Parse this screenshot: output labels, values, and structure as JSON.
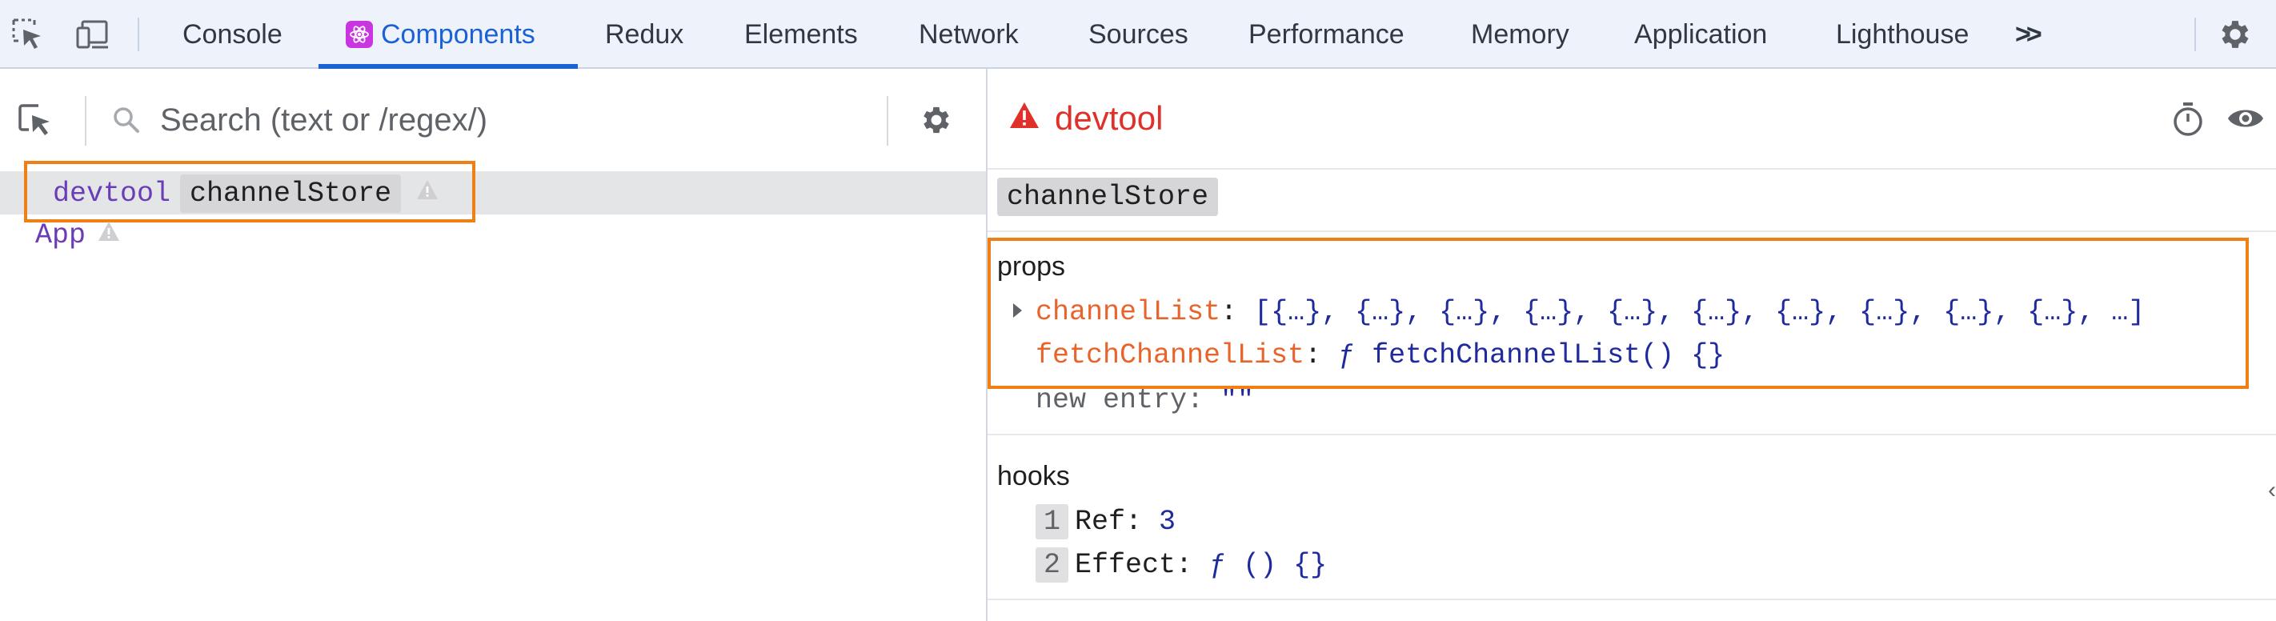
{
  "toolbar": {
    "tabs": [
      {
        "label": "Console"
      },
      {
        "label": "Components"
      },
      {
        "label": "Redux"
      },
      {
        "label": "Elements"
      },
      {
        "label": "Network"
      },
      {
        "label": "Sources"
      },
      {
        "label": "Performance"
      },
      {
        "label": "Memory"
      },
      {
        "label": "Application"
      },
      {
        "label": "Lighthouse"
      }
    ],
    "active_tab": "Components",
    "more_label": ">>"
  },
  "tree": {
    "search_placeholder": "Search (text or /regex/)",
    "items": [
      {
        "name": "devtool",
        "key": "channelStore",
        "selected": true,
        "warning": true
      },
      {
        "name": "App",
        "warning": true
      }
    ]
  },
  "inspector": {
    "component_name": "devtool",
    "key_label": "channelStore",
    "props": {
      "title": "props",
      "entries": [
        {
          "key": "channelList",
          "value": "[{…}, {…}, {…}, {…}, {…}, {…}, {…}, {…}, {…}, {…}, …]",
          "expandable": true
        },
        {
          "key": "fetchChannelList",
          "value": "ƒ fetchChannelList() {}"
        }
      ],
      "new_entry": {
        "key": "new entry",
        "value": "\"\""
      }
    },
    "hooks": {
      "title": "hooks",
      "entries": [
        {
          "index": "1",
          "name": "Ref",
          "value": "3"
        },
        {
          "index": "2",
          "name": "Effect",
          "value": "ƒ () {}"
        }
      ]
    }
  },
  "colors": {
    "accent": "#1a61d6",
    "highlight": "#f07f16",
    "error": "#e0302a",
    "component": "#6a3cb8",
    "prop_key": "#e8642a",
    "value": "#1f2a9c"
  }
}
